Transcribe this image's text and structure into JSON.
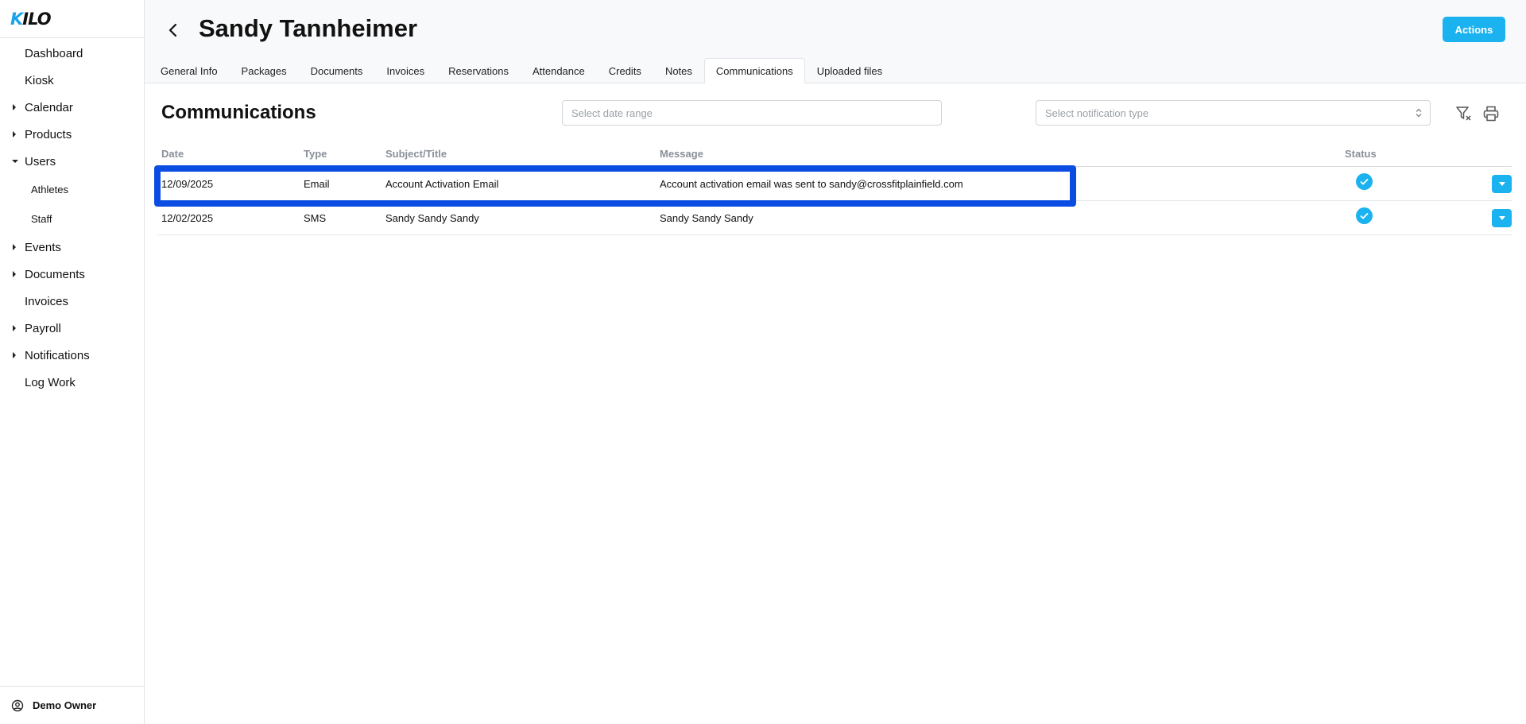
{
  "app": {
    "logo_k": "K",
    "logo_rest": "ILO"
  },
  "sidebar": {
    "items": [
      {
        "label": "Dashboard",
        "caret": "none"
      },
      {
        "label": "Kiosk",
        "caret": "none"
      },
      {
        "label": "Calendar",
        "caret": "right"
      },
      {
        "label": "Products",
        "caret": "right"
      },
      {
        "label": "Users",
        "caret": "down"
      },
      {
        "label": "Athletes",
        "caret": "sub"
      },
      {
        "label": "Staff",
        "caret": "sub"
      },
      {
        "label": "Events",
        "caret": "right"
      },
      {
        "label": "Documents",
        "caret": "right"
      },
      {
        "label": "Invoices",
        "caret": "none"
      },
      {
        "label": "Payroll",
        "caret": "right"
      },
      {
        "label": "Notifications",
        "caret": "right"
      },
      {
        "label": "Log Work",
        "caret": "none"
      }
    ],
    "footer_user": "Demo Owner"
  },
  "header": {
    "title": "Sandy Tannheimer",
    "actions_label": "Actions",
    "tabs": [
      {
        "label": "General Info"
      },
      {
        "label": "Packages"
      },
      {
        "label": "Documents"
      },
      {
        "label": "Invoices"
      },
      {
        "label": "Reservations"
      },
      {
        "label": "Attendance"
      },
      {
        "label": "Credits"
      },
      {
        "label": "Notes"
      },
      {
        "label": "Communications",
        "active": true
      },
      {
        "label": "Uploaded files"
      }
    ]
  },
  "main": {
    "section_title": "Communications",
    "date_range_placeholder": "Select date range",
    "notification_type_placeholder": "Select notification type",
    "columns": [
      "Date",
      "Type",
      "Subject/Title",
      "Message",
      "Status"
    ],
    "rows": [
      {
        "date": "12/09/2025",
        "type": "Email",
        "subject": "Account Activation Email",
        "message": "Account activation email was sent to sandy@crossfitplainfield.com",
        "status": "check-circle-icon"
      },
      {
        "date": "12/02/2025",
        "type": "SMS",
        "subject": "Sandy Sandy Sandy",
        "message": "Sandy Sandy Sandy",
        "status": "check-circle-icon"
      }
    ]
  },
  "colors": {
    "accent": "#1ab2ef",
    "highlight": "#0b4de3"
  }
}
